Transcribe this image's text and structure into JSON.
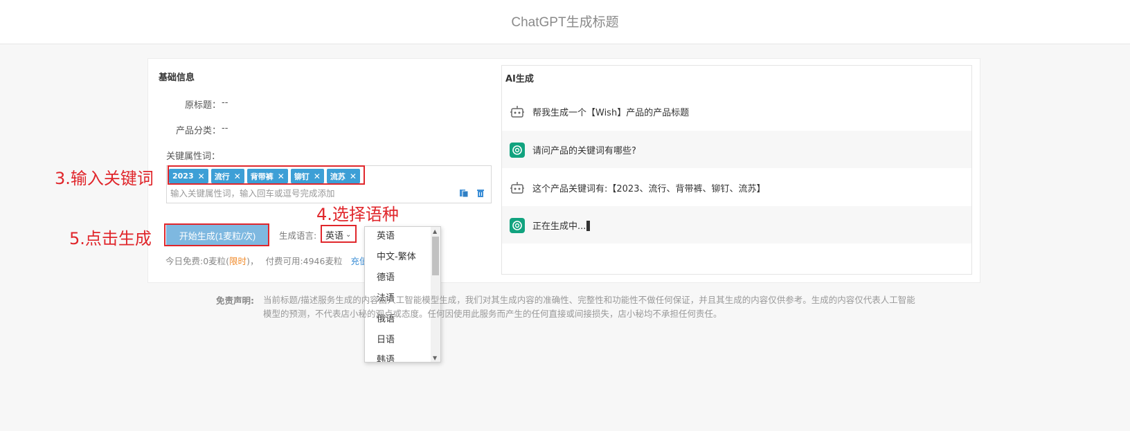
{
  "header": {
    "title": "ChatGPT生成标题"
  },
  "basic": {
    "section_title": "基础信息",
    "original_title_label": "原标题：",
    "original_title_value": "--",
    "category_label": "产品分类：",
    "category_value": "--",
    "keywords_label": "关键属性词："
  },
  "keywords": {
    "tags": [
      "2023",
      "流行",
      "背带裤",
      "铆钉",
      "流苏"
    ],
    "remove_glyph": "✕",
    "placeholder": "输入关键属性词，输入回车或逗号完成添加"
  },
  "generate": {
    "button_label": "开始生成(1麦粒/次)",
    "language_label": "生成语言:",
    "language_value": "英语"
  },
  "credit": {
    "free_prefix": "今日免费:0麦粒(",
    "limited": "限时",
    "free_suffix": ")，",
    "paid": "付费可用:4946麦粒",
    "recharge": "充值"
  },
  "language_dropdown": {
    "options": [
      "英语",
      "中文-繁体",
      "德语",
      "法语",
      "俄语",
      "日语",
      "韩语"
    ]
  },
  "annotations": {
    "step3": "3.输入关键词",
    "step4": "4.选择语种",
    "step5": "5.点击生成"
  },
  "ai": {
    "title": "AI生成",
    "messages": [
      {
        "role": "bot",
        "text": "帮我生成一个【Wish】产品的产品标题"
      },
      {
        "role": "gpt",
        "text": "请问产品的关键词有哪些?"
      },
      {
        "role": "bot",
        "text": "这个产品关键词有:【2023、流行、背带裤、铆钉、流苏】"
      },
      {
        "role": "gpt",
        "text": "正在生成中..."
      }
    ]
  },
  "disclaimer": {
    "label": "免责声明:",
    "text": "当前标题/描述服务生成的内容由人工智能模型生成，我们对其生成内容的准确性、完整性和功能性不做任何保证，并且其生成的内容仅供参考。生成的内容仅代表人工智能模型的预测，不代表店小秘的观点或态度。任何因使用此服务而产生的任何直接或间接损失，店小秘均不承担任何责任。"
  },
  "colors": {
    "accent": "#3d9fd6",
    "button": "#7eb8e0",
    "annotation": "#e0262b",
    "gpt_green": "#11a37f"
  }
}
